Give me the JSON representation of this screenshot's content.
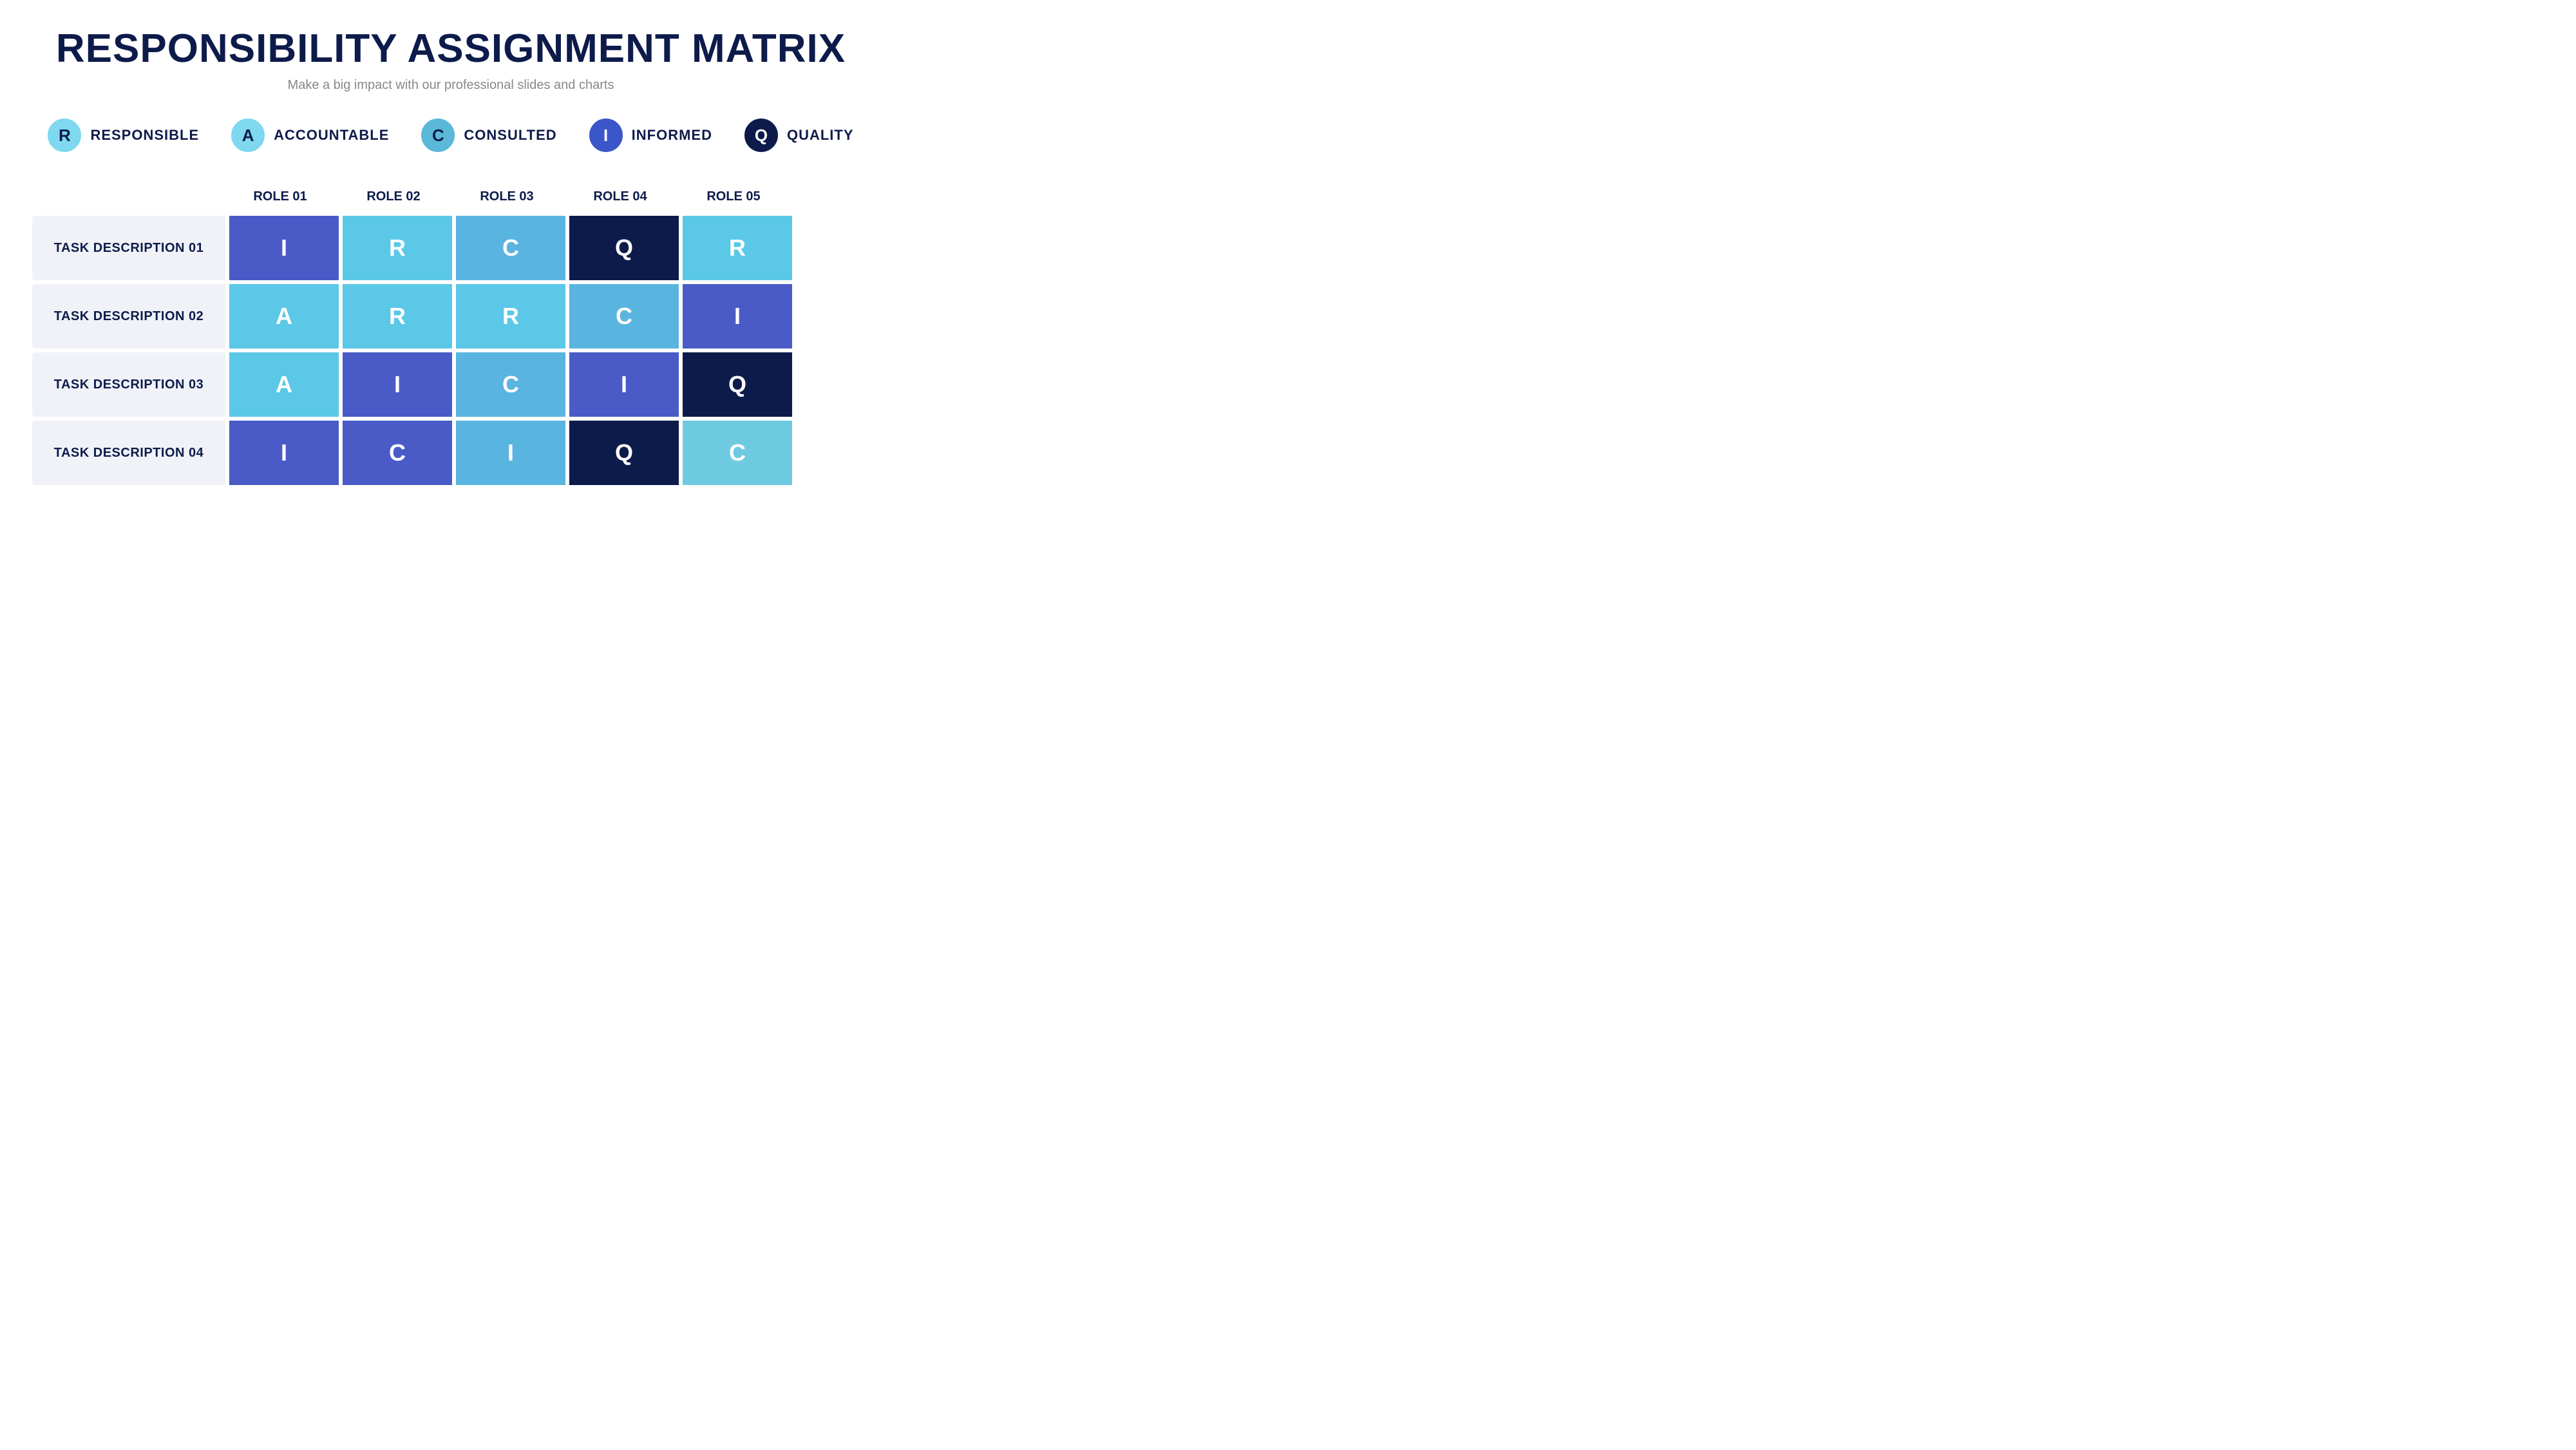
{
  "title": "RESPONSIBILITY ASSIGNMENT MATRIX",
  "subtitle": "Make a big impact with our professional slides and charts",
  "legend": {
    "items": [
      {
        "id": "responsible",
        "letter": "R",
        "label": "RESPONSIBLE",
        "bg": "#7dd8f0",
        "color": "#0d1b4b"
      },
      {
        "id": "accountable",
        "letter": "A",
        "label": "ACCOUNTABLE",
        "bg": "#7dd8f0",
        "color": "#0d1b4b"
      },
      {
        "id": "consulted",
        "letter": "C",
        "label": "CONSULTED",
        "bg": "#5ab8d8",
        "color": "#0d1b4b"
      },
      {
        "id": "informed",
        "letter": "I",
        "label": "INFORMED",
        "bg": "#3a56c8",
        "color": "#ffffff"
      },
      {
        "id": "quality",
        "letter": "Q",
        "label": "QUALITY",
        "bg": "#0d1b4b",
        "color": "#ffffff"
      }
    ]
  },
  "roles": [
    "ROLE 01",
    "ROLE 02",
    "ROLE 03",
    "ROLE 04",
    "ROLE 05"
  ],
  "tasks": [
    {
      "label": "TASK DESCRIPTION 01",
      "cells": [
        {
          "letter": "I",
          "bg": "#4a5bc7"
        },
        {
          "letter": "R",
          "bg": "#5bc8e8"
        },
        {
          "letter": "C",
          "bg": "#5ab4e0"
        },
        {
          "letter": "Q",
          "bg": "#0d1b4b"
        },
        {
          "letter": "R",
          "bg": "#5bc8e8"
        }
      ]
    },
    {
      "label": "TASK DESCRIPTION 02",
      "cells": [
        {
          "letter": "A",
          "bg": "#5bc8e8"
        },
        {
          "letter": "R",
          "bg": "#5bc8e8"
        },
        {
          "letter": "R",
          "bg": "#5bc8e8"
        },
        {
          "letter": "C",
          "bg": "#5ab4e0"
        },
        {
          "letter": "I",
          "bg": "#4a5bc7"
        }
      ]
    },
    {
      "label": "TASK DESCRIPTION 03",
      "cells": [
        {
          "letter": "A",
          "bg": "#5bc8e8"
        },
        {
          "letter": "I",
          "bg": "#4a5bc7"
        },
        {
          "letter": "C",
          "bg": "#5ab4e0"
        },
        {
          "letter": "I",
          "bg": "#4a5bc7"
        },
        {
          "letter": "Q",
          "bg": "#0d1b4b"
        }
      ]
    },
    {
      "label": "TASK DESCRIPTION 04",
      "cells": [
        {
          "letter": "I",
          "bg": "#4a5bc7"
        },
        {
          "letter": "C",
          "bg": "#4a5bc7"
        },
        {
          "letter": "I",
          "bg": "#5ab4e0"
        },
        {
          "letter": "Q",
          "bg": "#0d1b4b"
        },
        {
          "letter": "C",
          "bg": "#6ecae0"
        }
      ]
    }
  ]
}
